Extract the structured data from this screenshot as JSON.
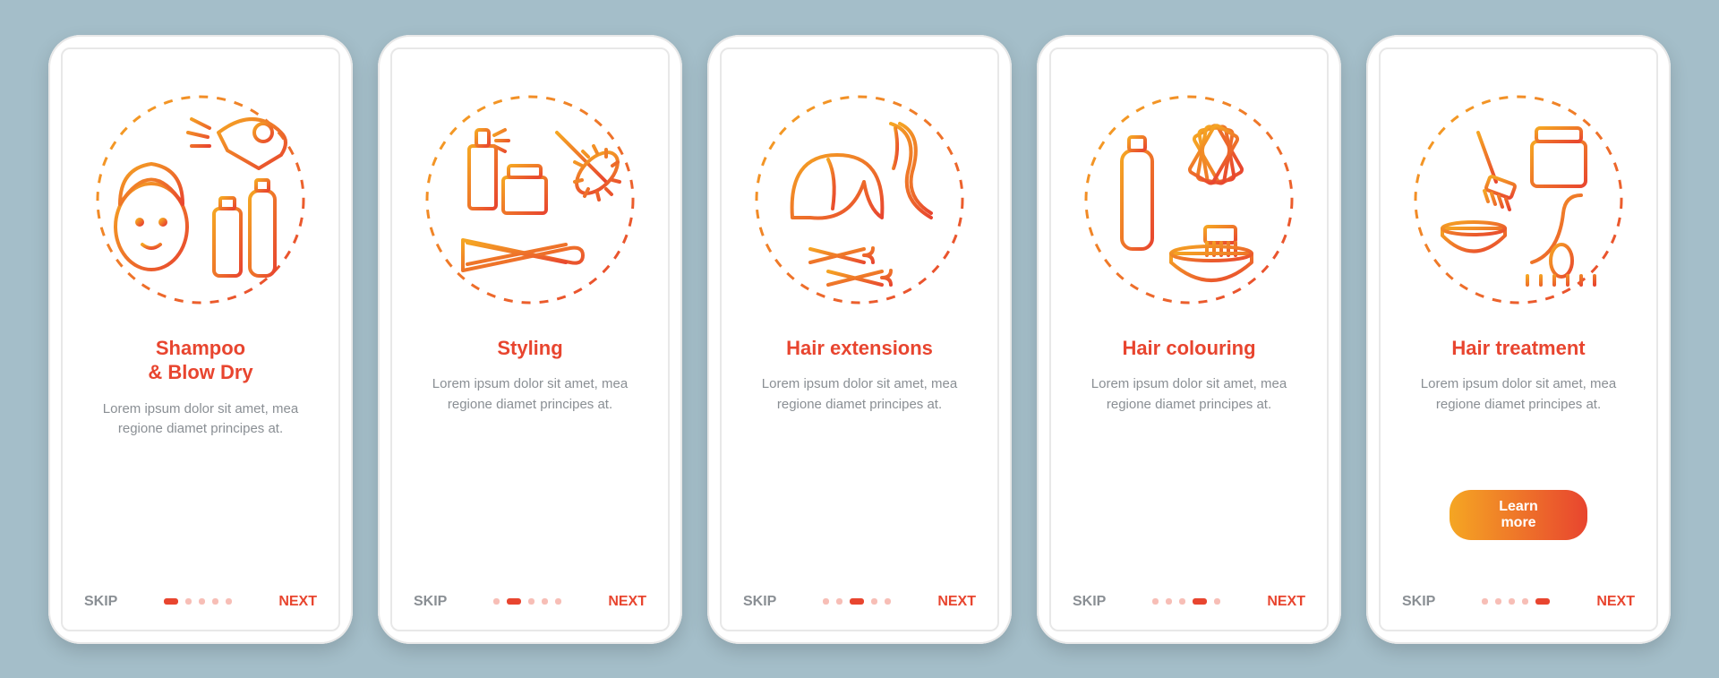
{
  "colors": {
    "accent": "#e8452f",
    "grad_start": "#f5a623",
    "grad_end": "#e8452f",
    "muted": "#8a8f94"
  },
  "common": {
    "skip": "SKIP",
    "next": "NEXT",
    "desc": "Lorem ipsum dolor sit amet, mea regione diamet principes at.",
    "learn_more": "Learn more"
  },
  "screens": [
    {
      "title": "Shampoo\n& Blow Dry",
      "icon": "shampoo-blow-dry-icon",
      "active_dot": 0,
      "has_button": false
    },
    {
      "title": "Styling",
      "icon": "styling-icon",
      "active_dot": 1,
      "has_button": false
    },
    {
      "title": "Hair extensions",
      "icon": "hair-extensions-icon",
      "active_dot": 2,
      "has_button": false
    },
    {
      "title": "Hair colouring",
      "icon": "hair-colouring-icon",
      "active_dot": 3,
      "has_button": false
    },
    {
      "title": "Hair treatment",
      "icon": "hair-treatment-icon",
      "active_dot": 4,
      "has_button": true
    }
  ]
}
